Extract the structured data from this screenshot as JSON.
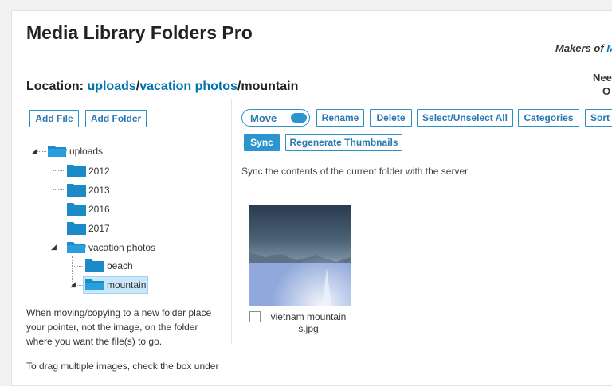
{
  "header": {
    "title": "Media Library Folders Pro",
    "makers_prefix": "Makers of ",
    "makers_link": "M",
    "need_line1": "Nee",
    "need_line2": "O"
  },
  "location": {
    "label": "Location: ",
    "crumbs": [
      "uploads",
      "vacation photos"
    ],
    "separator": "/",
    "current": "mountain"
  },
  "left_toolbar": {
    "add_file": "Add File",
    "add_folder": "Add Folder"
  },
  "tree": {
    "root": "uploads",
    "children": [
      "2012",
      "2013",
      "2016",
      "2017",
      "vacation photos"
    ],
    "vacation_children": [
      "beach",
      "mountain"
    ],
    "selected": "mountain"
  },
  "toolbar": {
    "move_label": "Move",
    "rename": "Rename",
    "delete": "Delete",
    "select_all": "Select/Unselect All",
    "categories": "Categories",
    "sort": "Sort",
    "sync": "Sync",
    "regenerate": "Regenerate Thumbnails"
  },
  "sync_description": "Sync the contents of the current folder with the server",
  "files": [
    {
      "name_line1": "vietnam mountain",
      "name_line2": "s.jpg"
    }
  ],
  "help": {
    "p1": "When moving/copying to a new folder place your pointer, not the image, on the folder where you want the file(s) to go.",
    "p2": "To drag multiple images, check the box under"
  },
  "colors": {
    "accent": "#2c95cf",
    "link": "#0073aa",
    "selected_bg": "#cbe8fb",
    "folder": "#1b8bc7"
  }
}
